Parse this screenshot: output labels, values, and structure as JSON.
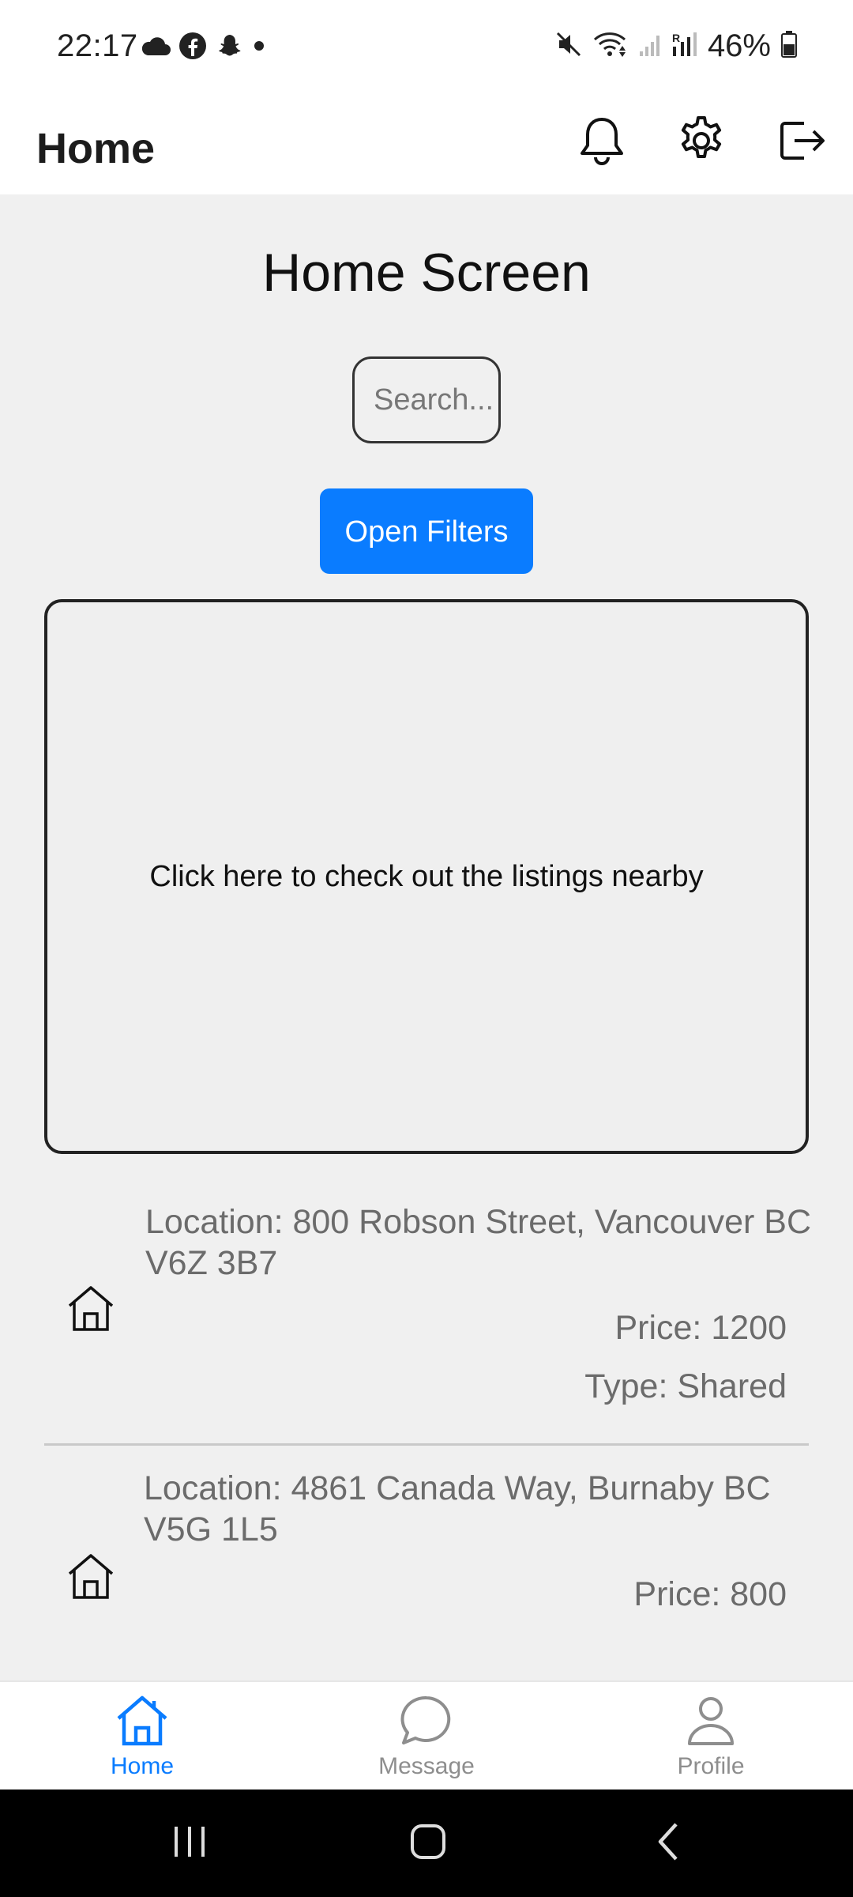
{
  "status_bar": {
    "time": "22:17",
    "battery": "46%",
    "left_icons": [
      "cloud-icon",
      "facebook-icon",
      "snapchat-icon",
      "notification-dot-icon"
    ],
    "right_icons": [
      "mute-icon",
      "wifi-icon",
      "signal-icon",
      "signal-roaming-icon",
      "battery-icon"
    ]
  },
  "app_bar": {
    "title": "Home",
    "actions": [
      "bell-icon",
      "gear-icon",
      "logout-icon"
    ]
  },
  "main": {
    "title": "Home Screen",
    "search_placeholder": "Search...",
    "filters_button": "Open Filters",
    "map_prompt": "Click here to check out the listings nearby"
  },
  "listings": [
    {
      "location": "Location: 800 Robson Street, Vancouver BC V6Z 3B7",
      "price": "Price: 1200",
      "type": "Type: Shared"
    },
    {
      "location": "Location: 4861 Canada Way, Burnaby BC V5G 1L5",
      "price": "Price: 800"
    }
  ],
  "tabs": [
    {
      "label": "Home",
      "icon": "home-icon",
      "active": true
    },
    {
      "label": "Message",
      "icon": "message-icon",
      "active": false
    },
    {
      "label": "Profile",
      "icon": "profile-icon",
      "active": false
    }
  ],
  "colors": {
    "accent": "#0a7cff",
    "inactive_tab": "#8e8e8e",
    "content_background": "#f0f0f0",
    "listing_text": "#6b6b6b"
  },
  "system_nav": [
    "recents-icon",
    "home-nav-icon",
    "back-icon"
  ]
}
